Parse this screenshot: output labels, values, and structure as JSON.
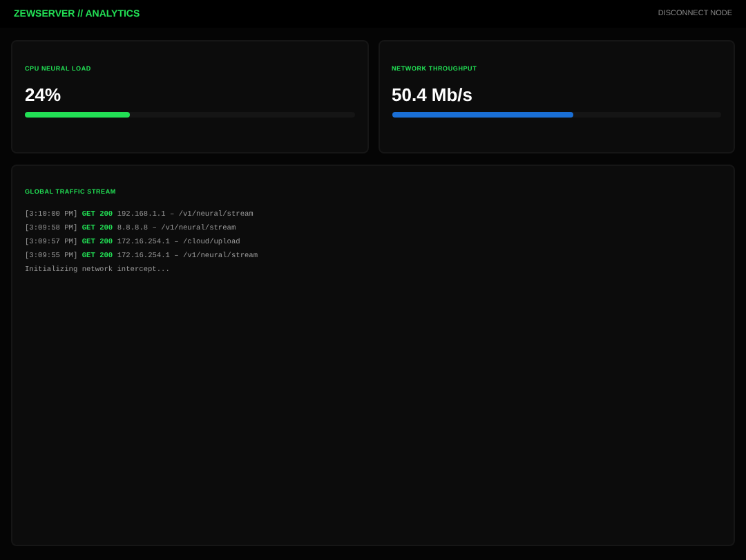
{
  "header": {
    "title": "ZEWSERVER // ANALYTICS",
    "action": "DISCONNECT NODE"
  },
  "metrics": [
    {
      "label": "CPU NEURAL LOAD",
      "value": "24%",
      "level": 0.32,
      "color": "#22e055"
    },
    {
      "label": "NETWORK THROUGHPUT",
      "value": "50.4 Mb/s",
      "level": 0.55,
      "color": "#1a6fd6"
    }
  ],
  "stream": {
    "title": "GLOBAL TRAFFIC STREAM",
    "lines": [
      {
        "kind": "request",
        "time": "[3:10:00 PM]",
        "method": "GET",
        "status": "200",
        "detail": "192.168.1.1 – /v1/neural/stream"
      },
      {
        "kind": "request",
        "time": "[3:09:58 PM]",
        "method": "GET",
        "status": "200",
        "detail": "8.8.8.8 – /v1/neural/stream"
      },
      {
        "kind": "request",
        "time": "[3:09:57 PM]",
        "method": "GET",
        "status": "200",
        "detail": "172.16.254.1 – /cloud/upload"
      },
      {
        "kind": "request",
        "time": "[3:09:55 PM]",
        "method": "GET",
        "status": "200",
        "detail": "172.16.254.1 – /v1/neural/stream"
      },
      {
        "kind": "info",
        "text": "Initializing network intercept..."
      }
    ]
  }
}
